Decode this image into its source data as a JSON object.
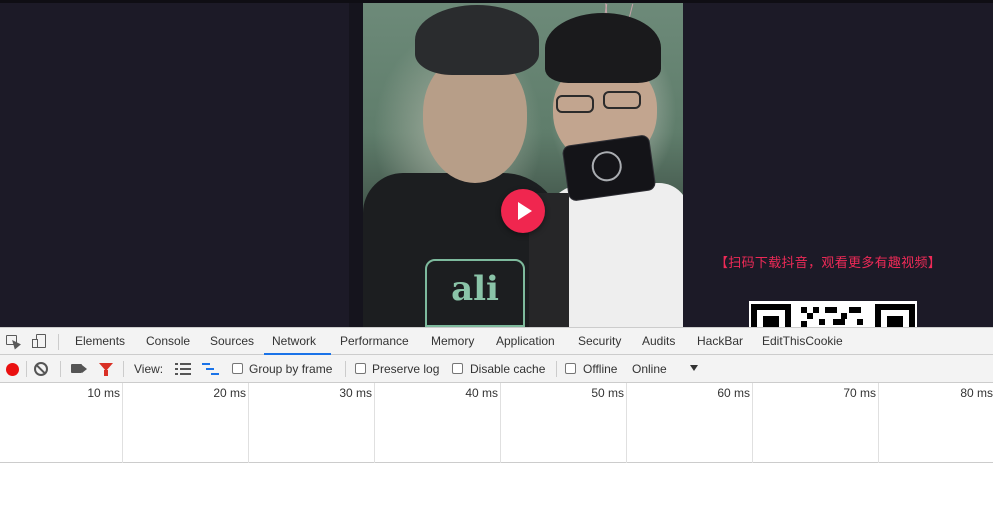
{
  "page": {
    "download_prompt": "【扫码下载抖音，观看更多有趣视频】",
    "video_print_text": "ali"
  },
  "devtools": {
    "tabs": [
      {
        "label": "Elements",
        "active": false
      },
      {
        "label": "Console",
        "active": false
      },
      {
        "label": "Sources",
        "active": false
      },
      {
        "label": "Network",
        "active": true
      },
      {
        "label": "Performance",
        "active": false
      },
      {
        "label": "Memory",
        "active": false
      },
      {
        "label": "Application",
        "active": false
      },
      {
        "label": "Security",
        "active": false
      },
      {
        "label": "Audits",
        "active": false
      },
      {
        "label": "HackBar",
        "active": false
      },
      {
        "label": "EditThisCookie",
        "active": false
      }
    ],
    "toolbar": {
      "view_label": "View:",
      "group_by_frame": {
        "label": "Group by frame",
        "checked": false
      },
      "preserve_log": {
        "label": "Preserve log",
        "checked": false
      },
      "disable_cache": {
        "label": "Disable cache",
        "checked": false
      },
      "offline": {
        "label": "Offline",
        "checked": false
      },
      "throttling": "Online"
    },
    "timeline_ticks": [
      "10 ms",
      "20 ms",
      "30 ms",
      "40 ms",
      "50 ms",
      "60 ms",
      "70 ms",
      "80 ms"
    ]
  },
  "colors": {
    "page_background": "#1c1a27",
    "accent_pink": "#ee2a57",
    "play_button": "#f0264f",
    "record_red": "#ea1010",
    "active_tab_underline": "#1a73e8"
  }
}
